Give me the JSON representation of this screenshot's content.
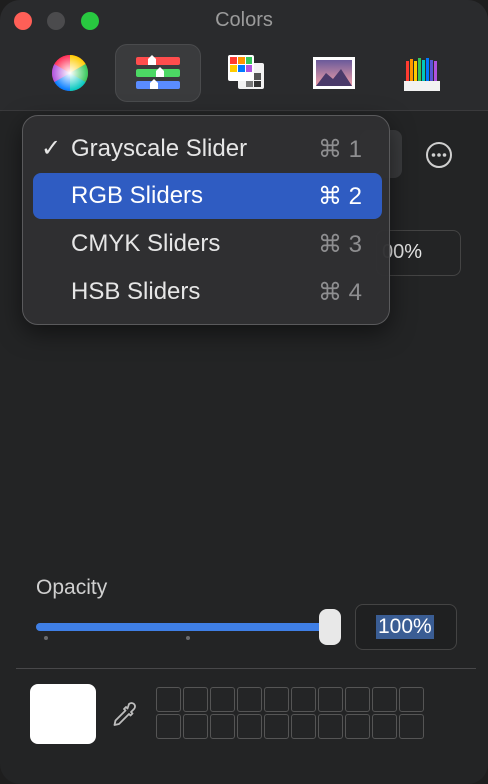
{
  "window": {
    "title": "Colors"
  },
  "toolbar": {
    "tools": [
      {
        "name": "color-wheel",
        "icon": "color-wheel-icon",
        "active": false
      },
      {
        "name": "color-sliders",
        "icon": "sliders-icon",
        "active": true
      },
      {
        "name": "color-palettes",
        "icon": "palettes-icon",
        "active": false
      },
      {
        "name": "image-palettes",
        "icon": "image-icon",
        "active": false
      },
      {
        "name": "pencils",
        "icon": "pencils-icon",
        "active": false
      }
    ]
  },
  "menu": {
    "items": [
      {
        "label": "Grayscale Slider",
        "shortcut": "⌘ 1",
        "checked": true,
        "selected": false
      },
      {
        "label": "RGB Sliders",
        "shortcut": "⌘ 2",
        "checked": false,
        "selected": true
      },
      {
        "label": "CMYK Sliders",
        "shortcut": "⌘ 3",
        "checked": false,
        "selected": false
      },
      {
        "label": "HSB Sliders",
        "shortcut": "⌘ 4",
        "checked": false,
        "selected": false
      }
    ],
    "check_glyph": "✓"
  },
  "background": {
    "value_text": "00%"
  },
  "opacity": {
    "label": "Opacity",
    "value": "100%",
    "fraction": 1.0
  },
  "colors": {
    "accent": "#2f5cc2",
    "slider_fill": "#3f7fe6",
    "current_color": "#ffffff"
  },
  "swatches": {
    "rows": 2,
    "cols": 10
  }
}
